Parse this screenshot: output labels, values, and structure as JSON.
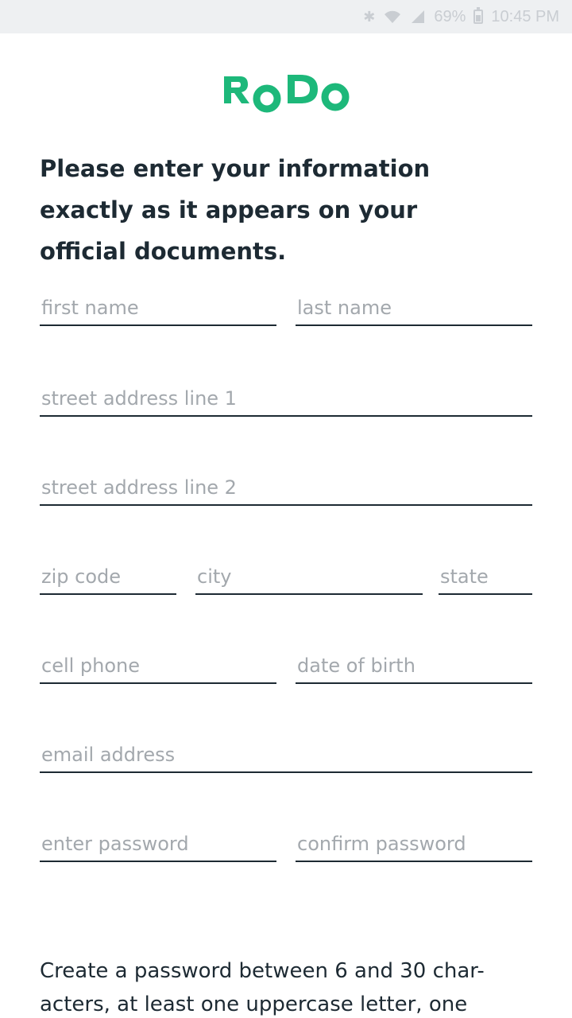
{
  "status_bar": {
    "battery_percent": "69%",
    "time": "10:45 PM",
    "icons": [
      "bluetooth-icon",
      "wifi-icon",
      "signal-icon",
      "battery-icon"
    ]
  },
  "logo": {
    "alt": "RODO",
    "color": "#1db87a"
  },
  "intro": {
    "text": "Please enter your information exactly as it appears on your official documents."
  },
  "form": {
    "first_name": {
      "placeholder": "first name",
      "value": ""
    },
    "last_name": {
      "placeholder": "last name",
      "value": ""
    },
    "street1": {
      "placeholder": "street address line 1",
      "value": ""
    },
    "street2": {
      "placeholder": "street address line 2",
      "value": ""
    },
    "zip": {
      "placeholder": "zip code",
      "value": ""
    },
    "city": {
      "placeholder": "city",
      "value": ""
    },
    "state": {
      "placeholder": "state",
      "value": ""
    },
    "cell_phone": {
      "placeholder": "cell phone",
      "value": ""
    },
    "date_of_birth": {
      "placeholder": "date of birth",
      "value": ""
    },
    "email": {
      "placeholder": "email address",
      "value": ""
    },
    "password": {
      "placeholder": "enter password",
      "value": ""
    },
    "confirm_password": {
      "placeholder": "confirm password",
      "value": ""
    }
  },
  "password_note": {
    "text": "Create a password between 6 and 30 char- acters, at least one uppercase letter, one"
  },
  "colors": {
    "text": "#1d2a33",
    "placeholder": "#a3a8ad",
    "brand": "#1db87a",
    "status_bar_bg": "#eef0f2"
  }
}
